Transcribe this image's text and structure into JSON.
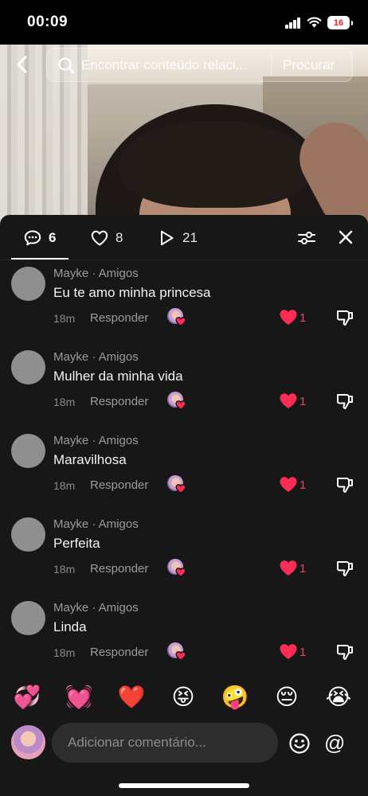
{
  "status_bar": {
    "time": "00:09",
    "battery": "16"
  },
  "search": {
    "placeholder": "Encontrar conteúdo relacionado",
    "display_text": "Encontrar conteúdo relaci...",
    "button_label": "Procurar"
  },
  "tabs": [
    {
      "icon": "comment-icon",
      "count": "6"
    },
    {
      "icon": "heart-outline-icon",
      "count": "8"
    },
    {
      "icon": "play-icon",
      "count": "21"
    }
  ],
  "comments": [
    {
      "author": "Mayke · Amigos",
      "text": "Eu te amo minha princesa",
      "time": "18m",
      "reply_label": "Responder",
      "likes": "1"
    },
    {
      "author": "Mayke · Amigos",
      "text": "Mulher da minha vida",
      "time": "18m",
      "reply_label": "Responder",
      "likes": "1"
    },
    {
      "author": "Mayke · Amigos",
      "text": "Maravilhosa",
      "time": "18m",
      "reply_label": "Responder",
      "likes": "1"
    },
    {
      "author": "Mayke · Amigos",
      "text": "Perfeita",
      "time": "18m",
      "reply_label": "Responder",
      "likes": "1"
    },
    {
      "author": "Mayke · Amigos",
      "text": "Linda",
      "time": "18m",
      "reply_label": "Responder",
      "likes": "1"
    }
  ],
  "quick_emojis": [
    "💞",
    "💓",
    "❤️",
    "😝",
    "🤪",
    "😔",
    "😭"
  ],
  "composer": {
    "placeholder": "Adicionar comentário...",
    "mention_label": "@"
  },
  "colors": {
    "sheet_bg": "#171717",
    "like_red": "#fe2c55",
    "input_bg": "#2d2d2d"
  }
}
